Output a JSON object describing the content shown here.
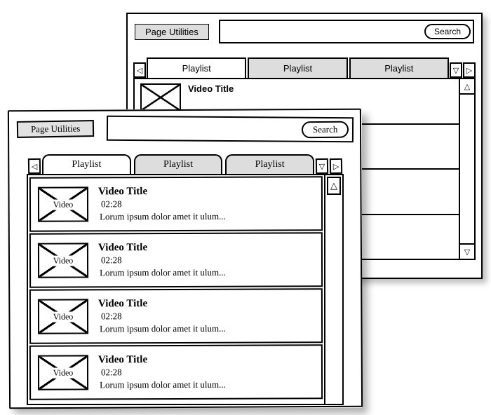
{
  "back": {
    "utilities_label": "Page Utilities",
    "search_placeholder": "",
    "search_button": "Search",
    "tabs": [
      "Playlist",
      "Playlist",
      "Playlist"
    ],
    "active_tab": 0,
    "arrow_left": "◁",
    "arrow_right": "▷",
    "arrow_down": "▽",
    "scroll_up": "△",
    "scroll_down": "▽",
    "rows": [
      {
        "title": "Video Title",
        "duration": ""
      },
      {},
      {},
      {}
    ]
  },
  "front": {
    "utilities_label": "Page Utilities",
    "search_placeholder": "",
    "search_button": "Search",
    "tabs": [
      "Playlist",
      "Playlist",
      "Playlist"
    ],
    "active_tab": 0,
    "arrow_left": "◁",
    "arrow_right": "▷",
    "arrow_down": "▽",
    "scroll_up": "△",
    "thumb_label": "Video",
    "rows": [
      {
        "title": "Video Title",
        "duration": "02:28",
        "summary": "Lorum ipsum dolor amet it ulum..."
      },
      {
        "title": "Video Title",
        "duration": "02:28",
        "summary": "Lorum ipsum dolor amet it ulum..."
      },
      {
        "title": "Video Title",
        "duration": "02:28",
        "summary": "Lorum ipsum dolor amet it ulum..."
      },
      {
        "title": "Video Title",
        "duration": "02:28",
        "summary": "Lorum ipsum dolor amet it ulum..."
      }
    ]
  }
}
